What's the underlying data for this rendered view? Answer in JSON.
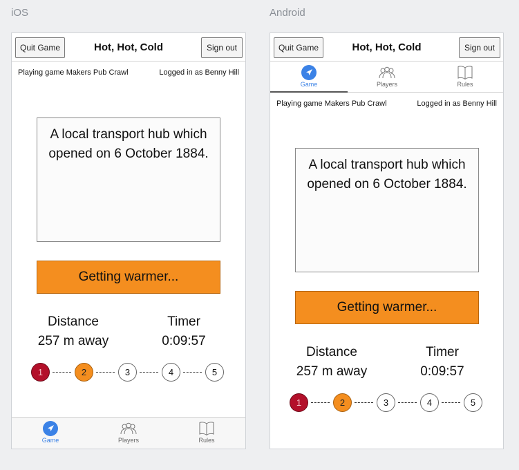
{
  "platforms": {
    "ios_label": "iOS",
    "android_label": "Android"
  },
  "header": {
    "quit_label": "Quit Game",
    "title": "Hot, Hot, Cold",
    "signout_label": "Sign out"
  },
  "status": {
    "game": "Playing game Makers Pub Crawl",
    "user": "Logged in as Benny Hill"
  },
  "clue": {
    "text": "A local transport hub which opened on 6 October 1884."
  },
  "warmth_button": {
    "label": "Getting warmer..."
  },
  "stats": {
    "distance_label": "Distance",
    "distance_value": "257 m away",
    "timer_label": "Timer",
    "timer_value": "0:09:57"
  },
  "progress": {
    "steps": [
      "1",
      "2",
      "3",
      "4",
      "5"
    ],
    "connector": "------"
  },
  "tabs": [
    {
      "label": "Game",
      "icon": "navigation-arrow-icon",
      "active": true
    },
    {
      "label": "Players",
      "icon": "players-group-icon",
      "active": false
    },
    {
      "label": "Rules",
      "icon": "open-book-icon",
      "active": false
    }
  ],
  "colors": {
    "accent_blue": "#3b82e6",
    "warmth_orange": "#f48e1f",
    "step_red": "#b3102a"
  }
}
